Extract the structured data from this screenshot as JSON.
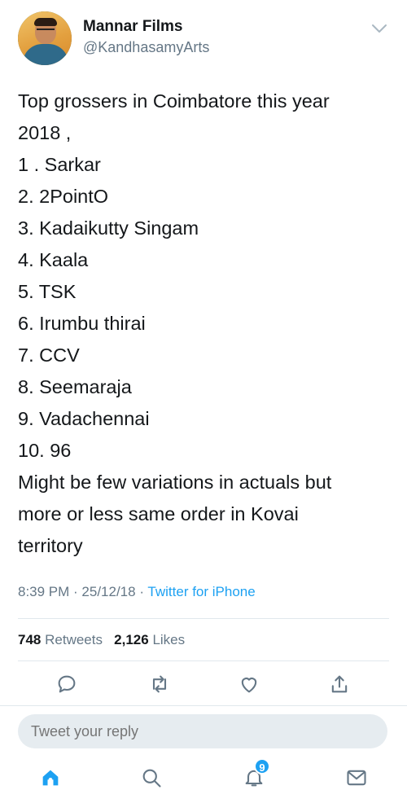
{
  "author": {
    "display_name": "Mannar Films",
    "handle": "@KandhasamyArts"
  },
  "tweet": {
    "lines": [
      "Top grossers in Coimbatore this year",
      "2018 ,",
      "1 . Sarkar",
      "2. 2PointO",
      "3. Kadaikutty Singam",
      "4. Kaala",
      "5. TSK",
      "6. Irumbu thirai",
      "7. CCV",
      "8. Seemaraja",
      "9. Vadachennai",
      "10. 96",
      "Might be few variations in actuals but",
      "more or less same order in Kovai",
      "territory"
    ]
  },
  "meta": {
    "time": "8:39 PM",
    "date": "25/12/18",
    "sep": " · ",
    "source": "Twitter for iPhone"
  },
  "stats": {
    "retweets_count": "748",
    "retweets_label": "Retweets",
    "likes_count": "2,126",
    "likes_label": "Likes"
  },
  "reply": {
    "placeholder": "Tweet your reply"
  },
  "tabbar": {
    "notifications_badge": "9"
  },
  "colors": {
    "accent": "#1da1f2",
    "text": "#14171a",
    "secondary": "#657786"
  },
  "icons": [
    "chevron-down-icon",
    "reply-icon",
    "retweet-icon",
    "like-icon",
    "share-icon",
    "home-icon",
    "search-icon",
    "notifications-icon",
    "messages-icon"
  ]
}
